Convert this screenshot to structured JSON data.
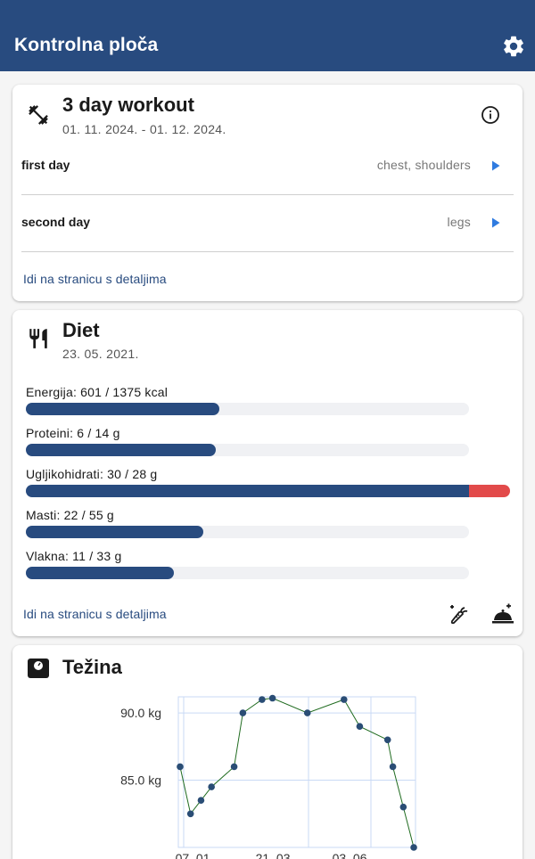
{
  "appbar": {
    "title": "Kontrolna ploča",
    "settings_icon": "gear-icon"
  },
  "workout": {
    "title": "3 day workout",
    "date_range": "01. 11. 2024. - 01. 12. 2024.",
    "icon": "dumbbell-icon",
    "days": [
      {
        "name": "first day",
        "muscles": "chest, shoulders"
      },
      {
        "name": "second day",
        "muscles": "legs"
      }
    ],
    "details_link": "Idi na stranicu s detaljima"
  },
  "diet": {
    "title": "Diet",
    "date": "23. 05. 2021.",
    "icon": "utensils-icon",
    "nutrients": [
      {
        "label": "Energija: 601 / 1375 kcal",
        "value": 601,
        "goal": 1375
      },
      {
        "label": "Proteini: 6 / 14 g",
        "value": 6,
        "goal": 14
      },
      {
        "label": "Ugljikohidrati: 30 / 28 g",
        "value": 30,
        "goal": 28
      },
      {
        "label": "Masti: 22 / 55 g",
        "value": 22,
        "goal": 55
      },
      {
        "label": "Vlakna: 11 / 33 g",
        "value": 11,
        "goal": 33
      }
    ],
    "details_link": "Idi na stranicu s detaljima",
    "colors": {
      "fill": "#284b7f",
      "over": "#e24a4a",
      "track": "#f0f1f4"
    }
  },
  "weight": {
    "title": "Težina",
    "icon": "scale-icon"
  },
  "chart_data": {
    "type": "line",
    "title": "",
    "xlabel": "",
    "ylabel": "",
    "y_unit": "kg",
    "x_ticks": [
      "07. 01.",
      "21. 03.",
      "03. 06."
    ],
    "y_ticks": [
      85.0,
      90.0
    ],
    "y_tick_labels": [
      "85.0 kg",
      "90.0 kg"
    ],
    "ylim": [
      80.0,
      91.2
    ],
    "grid": true,
    "series": [
      {
        "x_day": [
          1,
          7,
          13,
          19,
          32,
          37,
          48,
          54,
          74,
          95,
          104,
          120,
          123,
          129,
          135
        ],
        "values": [
          86.0,
          82.5,
          83.5,
          84.5,
          86.0,
          90.0,
          91.0,
          91.1,
          90.0,
          91.0,
          89.0,
          88.0,
          86.0,
          83.0,
          80.0
        ]
      }
    ],
    "line_color": "#1f6b1f",
    "marker_color": "#2a4d75"
  }
}
